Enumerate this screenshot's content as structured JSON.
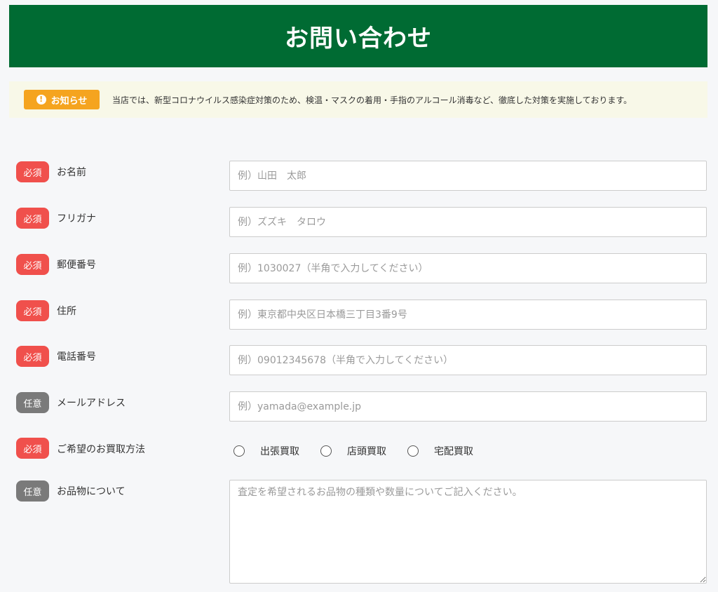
{
  "header": {
    "title": "お問い合わせ"
  },
  "notice": {
    "badge_label": "お知らせ",
    "badge_icon": "!",
    "text": "当店では、新型コロナウイルス感染症対策のため、検温・マスクの着用・手指のアルコール消毒など、徹底した対策を実施しております。"
  },
  "colors": {
    "header_bg": "#006b33",
    "notice_badge_bg": "#f5a41f",
    "required_badge_bg": "#f0504c",
    "optional_badge_bg": "#7a7a7a"
  },
  "form": {
    "name": {
      "badge": "必須",
      "label": "お名前",
      "placeholder": "例）山田　太郎"
    },
    "furigana": {
      "badge": "必須",
      "label": "フリガナ",
      "placeholder": "例）ズズキ　タロウ"
    },
    "postal": {
      "badge": "必須",
      "label": "郵便番号",
      "placeholder": "例）1030027（半角で入力してください）"
    },
    "address": {
      "badge": "必須",
      "label": "住所",
      "placeholder": "例）東京都中央区日本橋三丁目3番9号"
    },
    "phone": {
      "badge": "必須",
      "label": "電話番号",
      "placeholder": "例）09012345678（半角で入力してください）"
    },
    "email": {
      "badge": "任意",
      "label": "メールアドレス",
      "placeholder": "例）yamada@example.jp"
    },
    "method": {
      "badge": "必須",
      "label": "ご希望のお買取方法",
      "options": [
        "出張買取",
        "店頭買取",
        "宅配買取"
      ]
    },
    "items": {
      "badge": "任意",
      "label": "お品物について",
      "placeholder": "査定を希望されるお品物の種類や数量についてご記入ください。"
    }
  }
}
